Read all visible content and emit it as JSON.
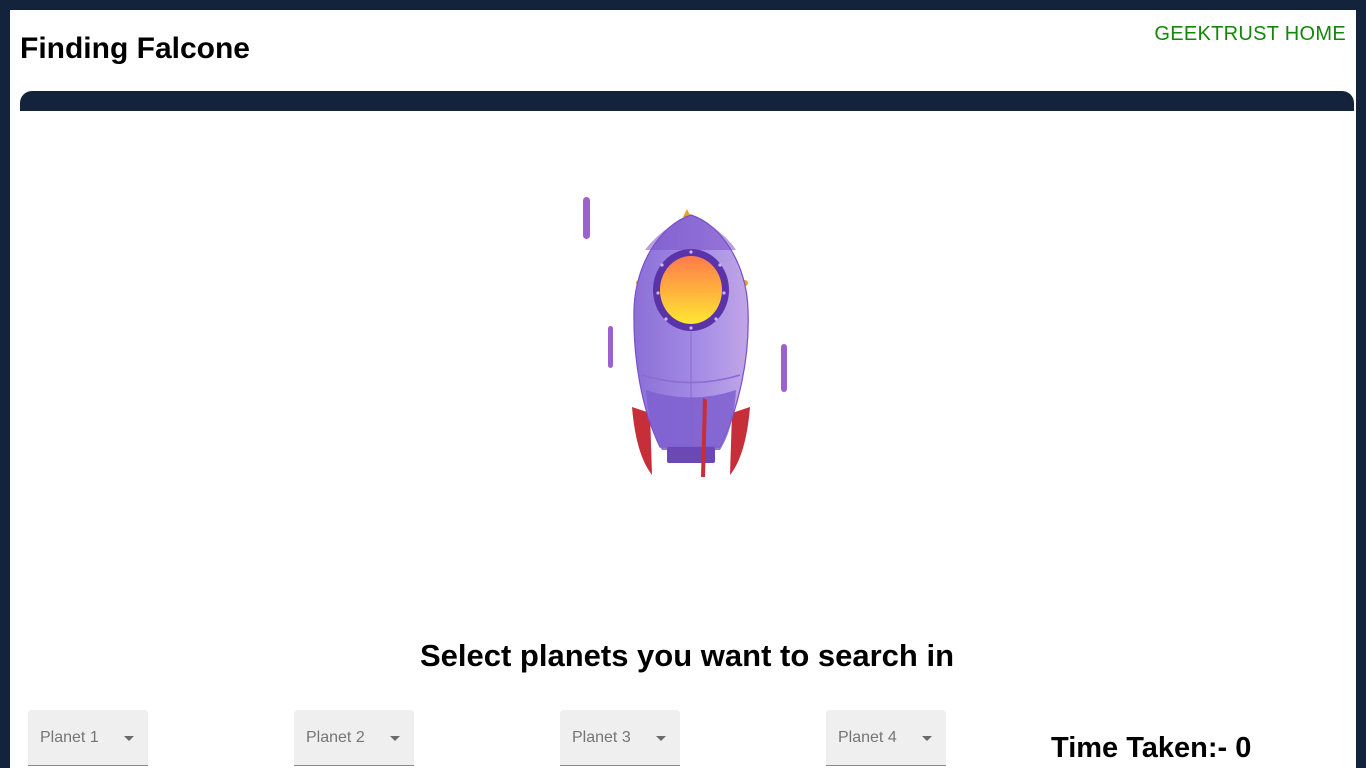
{
  "header": {
    "title": "Finding Falcone",
    "home_link": "GEEKTRUST HOME",
    "home_link_color": "#138808",
    "nav_bar_color": "#14233c"
  },
  "hero": {
    "image": "rocket-illustration"
  },
  "selection": {
    "heading": "Select planets you want to search in",
    "planets": [
      {
        "label": "Planet 1",
        "icon": "caret-down-icon"
      },
      {
        "label": "Planet 2",
        "icon": "caret-down-icon"
      },
      {
        "label": "Planet 3",
        "icon": "caret-down-icon"
      },
      {
        "label": "Planet 4",
        "icon": "caret-down-icon"
      }
    ]
  },
  "time_taken": {
    "label": "Time Taken:- ",
    "value": "0"
  }
}
